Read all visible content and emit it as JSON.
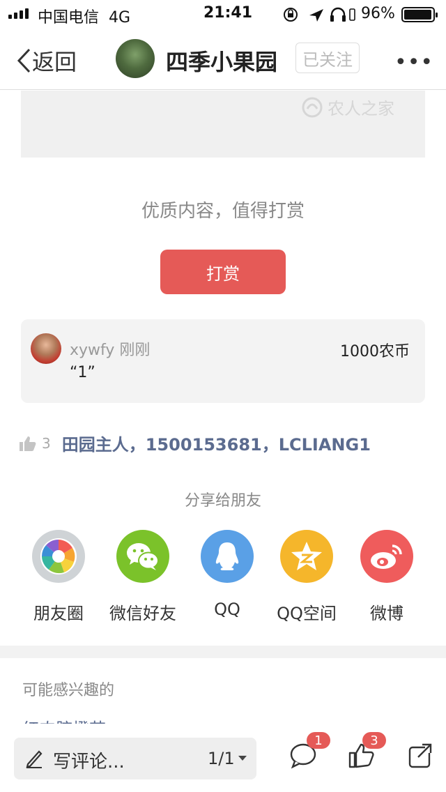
{
  "status_bar": {
    "carrier": "中国电信",
    "network": "4G",
    "time": "21:41",
    "battery": "96%"
  },
  "nav": {
    "back_label": "返回",
    "title": "四季小果园",
    "follow_label": "已关注"
  },
  "article": {
    "watermark": "农人之家"
  },
  "reward": {
    "prompt": "优质内容，值得打赏",
    "button_label": "打赏"
  },
  "tip": {
    "username": "xywfy",
    "time": "刚刚",
    "amount": "1000农币",
    "message": "“1”"
  },
  "likes": {
    "count": "3",
    "names": "田园主人，1500153681，LCLIANG1"
  },
  "share": {
    "title": "分享给朋友",
    "targets": [
      {
        "label": "朋友圈",
        "icon": "moments-icon",
        "color": "#cfd3d6"
      },
      {
        "label": "微信好友",
        "icon": "wechat-icon",
        "color": "#7bc22a"
      },
      {
        "label": "QQ",
        "icon": "qq-icon",
        "color": "#5aa0e6"
      },
      {
        "label": "QQ空间",
        "icon": "qzone-icon",
        "color": "#f5b62b"
      },
      {
        "label": "微博",
        "icon": "weibo-icon",
        "color": "#ef5c5c"
      }
    ]
  },
  "related": {
    "title": "可能感兴趣的",
    "peek_text": "红肉脐橙苗"
  },
  "bottom_bar": {
    "comment_placeholder": "写评论...",
    "page_indicator": "1/1",
    "comment_badge": "1",
    "like_badge": "3"
  },
  "colors": {
    "accent": "#e55a57",
    "link": "#5b6b8f"
  }
}
